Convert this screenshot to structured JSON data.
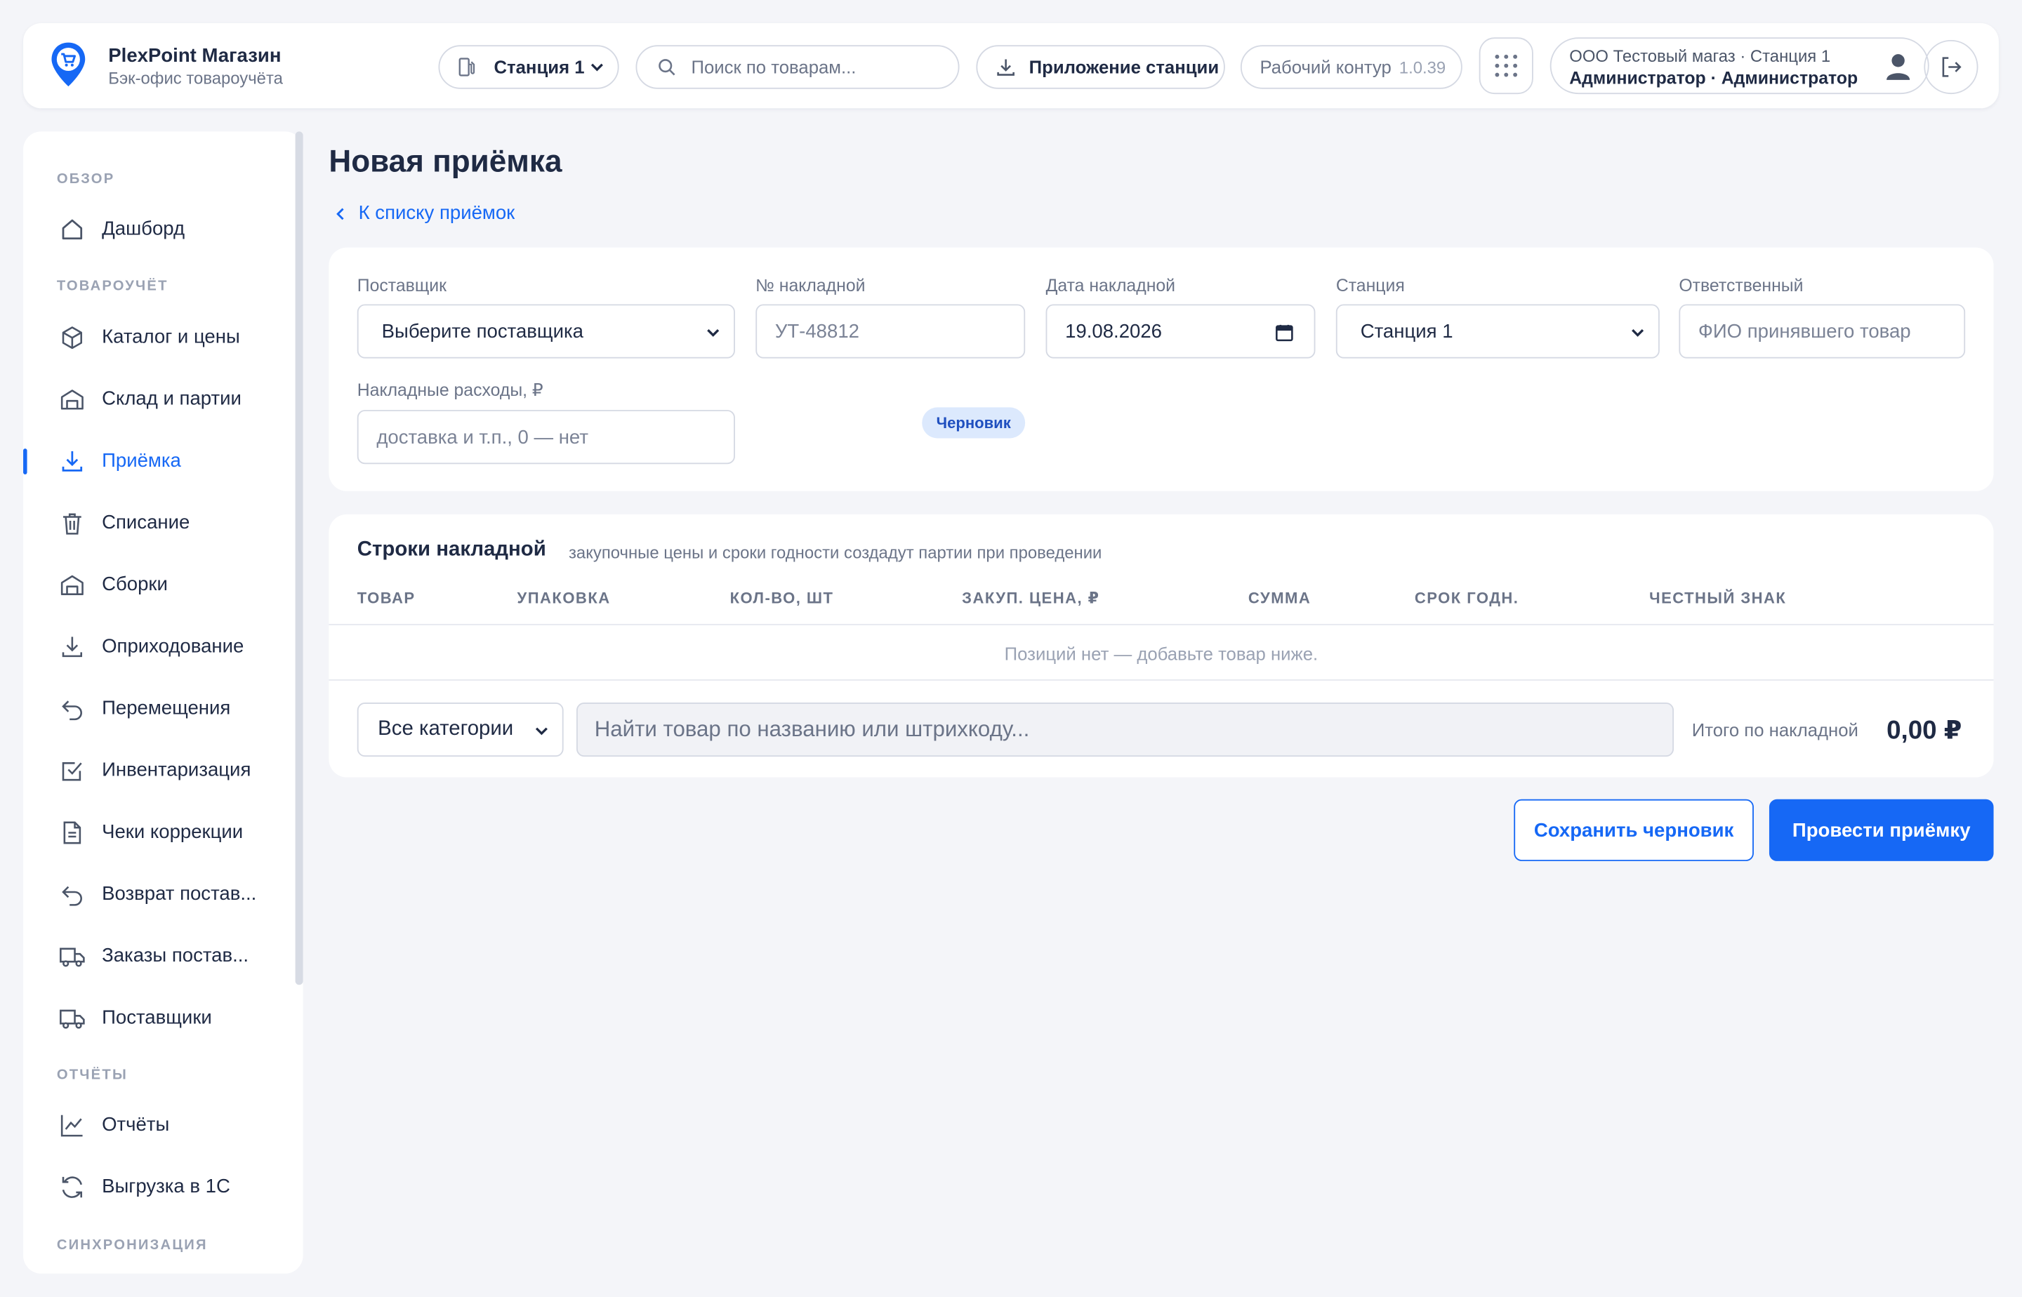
{
  "brand": {
    "title": "PlexPoint Магазин",
    "subtitle": "Бэк-офис товароучёта"
  },
  "header": {
    "station": "Станция 1",
    "search_placeholder": "Поиск по товарам...",
    "app_button": "Приложение станции",
    "contour": "Рабочий контур",
    "version": "1.0.39",
    "user_org": "ООО Тестовый магаз · Станция 1",
    "user_role": "Администратор · Администратор"
  },
  "sidebar": {
    "sections": [
      "ОБЗОР",
      "ТОВАРОУЧЁТ",
      "ОТЧЁТЫ",
      "СИНХРОНИЗАЦИЯ"
    ],
    "items": [
      {
        "label": "Дашборд",
        "icon": "home-icon"
      },
      {
        "label": "Каталог и цены",
        "icon": "box-icon"
      },
      {
        "label": "Склад и партии",
        "icon": "warehouse-icon"
      },
      {
        "label": "Приёмка",
        "icon": "download-icon",
        "active": true
      },
      {
        "label": "Списание",
        "icon": "trash-icon"
      },
      {
        "label": "Сборки",
        "icon": "warehouse-icon"
      },
      {
        "label": "Оприходование",
        "icon": "download-icon"
      },
      {
        "label": "Перемещения",
        "icon": "undo-icon"
      },
      {
        "label": "Инвентаризация",
        "icon": "checkbox-icon"
      },
      {
        "label": "Чеки коррекции",
        "icon": "document-icon"
      },
      {
        "label": "Возврат постав...",
        "icon": "undo-icon"
      },
      {
        "label": "Заказы постав...",
        "icon": "truck-icon"
      },
      {
        "label": "Поставщики",
        "icon": "truck-icon"
      },
      {
        "label": "Отчёты",
        "icon": "chart-icon"
      },
      {
        "label": "Выгрузка в 1С",
        "icon": "refresh-icon"
      }
    ]
  },
  "page": {
    "title": "Новая приёмка",
    "back_link": "К списку приёмок"
  },
  "form": {
    "supplier_label": "Поставщик",
    "supplier_value": "Выберите поставщика",
    "invoice_no_label": "№ накладной",
    "invoice_no_placeholder": "УТ-48812",
    "invoice_date_label": "Дата накладной",
    "invoice_date_value": "19.08.2026",
    "station_label": "Станция",
    "station_value": "Станция 1",
    "responsible_label": "Ответственный",
    "responsible_placeholder": "ФИО принявшего товар",
    "overhead_label": "Накладные расходы, ₽",
    "overhead_placeholder": "доставка и т.п., 0 — нет",
    "status_badge": "Черновик"
  },
  "lines": {
    "title": "Строки накладной",
    "subtitle": "закупочные цены и сроки годности создадут партии при проведении",
    "columns": [
      "ТОВАР",
      "УПАКОВКА",
      "КОЛ-ВО, ШТ",
      "ЗАКУП. ЦЕНА, ₽",
      "СУММА",
      "СРОК ГОДН.",
      "ЧЕСТНЫЙ ЗНАК"
    ],
    "empty_text": "Позиций нет — добавьте товар ниже.",
    "category_select": "Все категории",
    "product_search_placeholder": "Найти товар по названию или штрихкоду...",
    "total_label": "Итого по накладной",
    "total_value": "0,00 ₽"
  },
  "actions": {
    "save_draft": "Сохранить черновик",
    "post": "Провести приёмку"
  },
  "colors": {
    "accent": "#1668f5",
    "background": "#f4f5f9",
    "badge_bg": "#dce9fd"
  }
}
